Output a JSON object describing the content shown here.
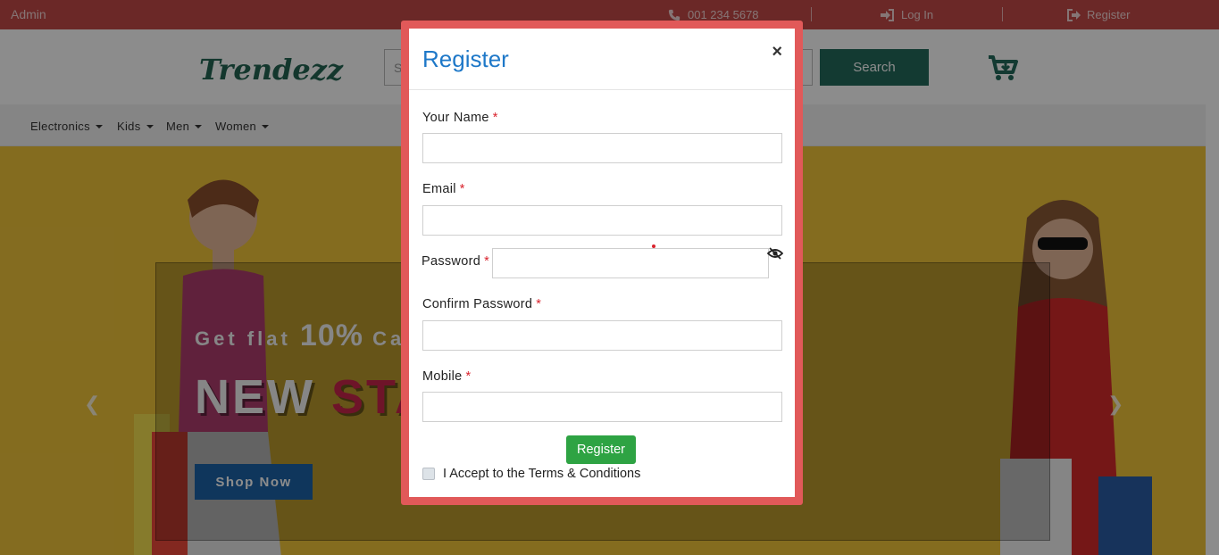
{
  "topbar": {
    "admin": "Admin",
    "phone": "001 234 5678",
    "login": "Log In",
    "register": "Register"
  },
  "header": {
    "logo": "Trendezz",
    "search_placeholder": "Se",
    "search_button": "Search"
  },
  "nav": {
    "items": [
      {
        "label": "Electronics"
      },
      {
        "label": "Kids"
      },
      {
        "label": "Men"
      },
      {
        "label": "Women"
      }
    ]
  },
  "hero": {
    "tag_prefix": "Get flat",
    "tag_value": "10%",
    "tag_suffix": "Ca",
    "headline_a": "NEW",
    "headline_b": "STA",
    "shop_button": "Shop Now"
  },
  "modal": {
    "title": "Register",
    "close": "×",
    "fields": {
      "name": {
        "label": "Your Name",
        "required": "*",
        "value": ""
      },
      "email": {
        "label": "Email",
        "required": "*",
        "value": ""
      },
      "password": {
        "label": "Password",
        "required": "*",
        "value": ""
      },
      "confirm": {
        "label": "Confirm Password",
        "required": "*",
        "value": ""
      },
      "mobile": {
        "label": "Mobile",
        "required": "*",
        "value": ""
      }
    },
    "submit": "Register",
    "terms": "I Accept to the Terms & Conditions"
  },
  "colors": {
    "topbar": "#c34a48",
    "brand_green": "#236b5c",
    "modal_frame": "#e15959",
    "title_blue": "#1e78c8",
    "submit_green": "#2ea343",
    "hero_yellow": "#f0c53a",
    "required_red": "#d9232d"
  },
  "icons": {
    "phone": "phone-icon",
    "login": "sign-in-icon",
    "register": "sign-out-icon",
    "cart": "cart-plus-icon",
    "eye": "eye-slash-icon",
    "close": "close-icon"
  }
}
